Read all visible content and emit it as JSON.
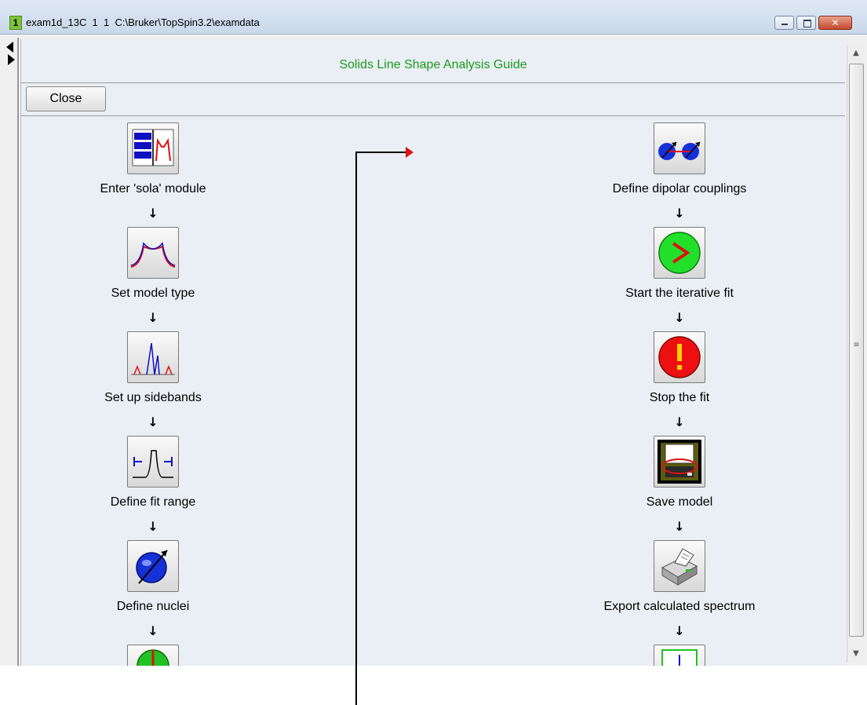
{
  "window": {
    "number": "1",
    "title": "exam1d_13C  1  1  C:\\Bruker\\TopSpin3.2\\examdata",
    "minimize_glyph": "",
    "maximize_glyph": "",
    "close_glyph": "✕"
  },
  "guide": {
    "title": "Solids Line Shape Analysis Guide",
    "close_label": "Close",
    "colors": {
      "title": "#1a9a1a",
      "connector_tip": "#e01010"
    }
  },
  "steps_left": [
    {
      "label": "Enter 'sola' module",
      "icon": "sola-module-icon"
    },
    {
      "label": "Set model type",
      "icon": "model-type-icon"
    },
    {
      "label": "Set up sidebands",
      "icon": "sidebands-icon"
    },
    {
      "label": "Define fit range",
      "icon": "fit-range-icon"
    },
    {
      "label": "Define nuclei",
      "icon": "nuclei-icon"
    }
  ],
  "steps_right": [
    {
      "label": "Define dipolar couplings",
      "icon": "dipolar-couplings-icon"
    },
    {
      "label": "Start the iterative fit",
      "icon": "start-fit-icon"
    },
    {
      "label": "Stop the fit",
      "icon": "stop-fit-icon"
    },
    {
      "label": "Save model",
      "icon": "save-model-icon"
    },
    {
      "label": "Export calculated spectrum",
      "icon": "export-spectrum-icon"
    }
  ],
  "arrow_glyph": "↓",
  "scrollbar": {
    "up_glyph": "▲",
    "down_glyph": "▼",
    "grip_glyph": "≡"
  }
}
